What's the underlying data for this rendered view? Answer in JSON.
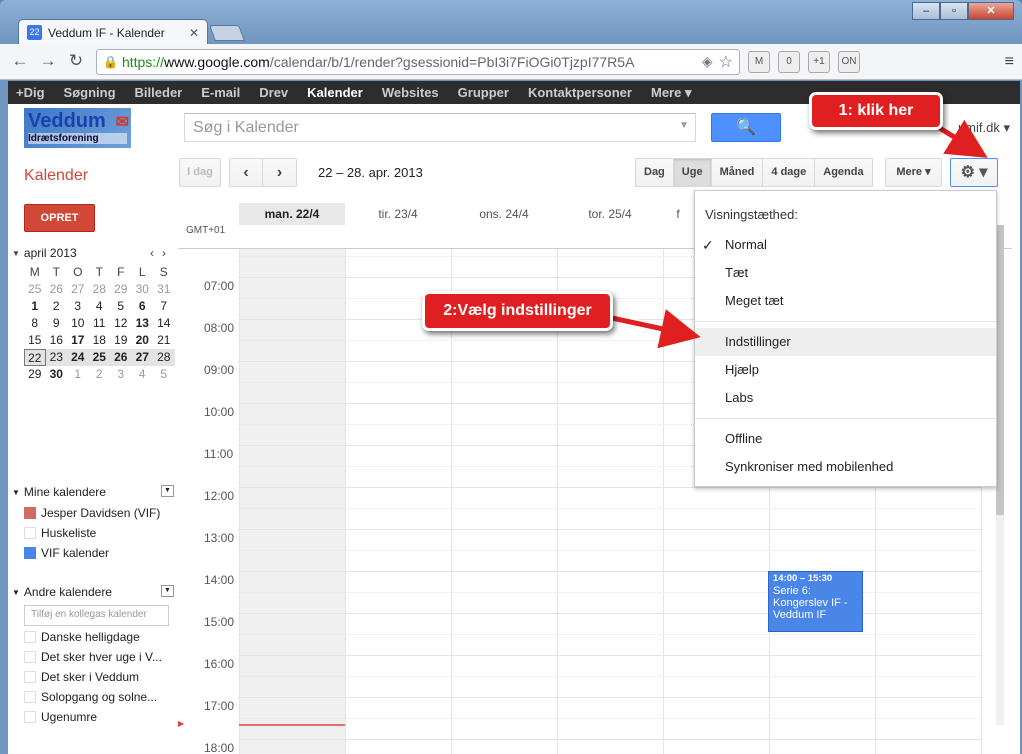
{
  "browser": {
    "tab_title": "Veddum IF - Kalender",
    "tab_favicon_text": "22",
    "url_scheme": "https://",
    "url_host": "www.google.com",
    "url_path": "/calendar/b/1/render?gsessionid=PbI3i7FiOGi0TjzpI77R5A",
    "ext_badge": "0"
  },
  "gbar": {
    "items": [
      "+Dig",
      "Søgning",
      "Billeder",
      "E-mail",
      "Drev",
      "Kalender",
      "Websites",
      "Grupper",
      "Kontaktpersoner",
      "Mere ▾"
    ],
    "active": "Kalender"
  },
  "header": {
    "logo_text": "Veddum",
    "logo_sub": "Idrætsforening",
    "search_placeholder": "Søg i Kalender",
    "account": "umif.dk ▾"
  },
  "calbar": {
    "app_name": "Kalender",
    "today_label": "I dag",
    "prev_label": "‹",
    "next_label": "›",
    "date_range": "22 – 28. apr. 2013",
    "views": [
      "Dag",
      "Uge",
      "Måned",
      "4 dage",
      "Agenda"
    ],
    "selected_view": "Uge",
    "more_label": "Mere ▾",
    "gear_label": "⚙ ▾"
  },
  "sidebar": {
    "create_label": "OPRET",
    "mini_month": "april 2013",
    "weekdays": [
      "M",
      "T",
      "O",
      "T",
      "F",
      "L",
      "S"
    ],
    "weeks": [
      [
        "25",
        "26",
        "27",
        "28",
        "29",
        "30",
        "31"
      ],
      [
        "1",
        "2",
        "3",
        "4",
        "5",
        "6",
        "7"
      ],
      [
        "8",
        "9",
        "10",
        "11",
        "12",
        "13",
        "14"
      ],
      [
        "15",
        "16",
        "17",
        "18",
        "19",
        "20",
        "21"
      ],
      [
        "22",
        "23",
        "24",
        "25",
        "26",
        "27",
        "28"
      ],
      [
        "29",
        "30",
        "1",
        "2",
        "3",
        "4",
        "5"
      ]
    ],
    "my_calendars_title": "Mine kalendere",
    "my_calendars": [
      {
        "label": "Jesper Davidsen (VIF)",
        "color": "#d06b64"
      },
      {
        "label": "Huskeliste",
        "color": "#ffffff"
      },
      {
        "label": "VIF kalender",
        "color": "#4986e7"
      }
    ],
    "other_calendars_title": "Andre kalendere",
    "add_colleague_placeholder": "Tilføj en kollegas kalender",
    "other_calendars": [
      "Danske helligdage",
      "Det sker hver uge i V...",
      "Det sker i Veddum",
      "Solopgang og solne...",
      "Ugenumre"
    ]
  },
  "grid": {
    "timezone": "GMT+01",
    "days": [
      "man. 22/4",
      "tir. 23/4",
      "ons. 24/4",
      "tor. 25/4",
      "f"
    ],
    "hours": [
      "07:00",
      "08:00",
      "09:00",
      "10:00",
      "11:00",
      "12:00",
      "13:00",
      "14:00",
      "15:00",
      "16:00",
      "17:00",
      "18:00"
    ],
    "event": {
      "time": "14:00 – 15:30",
      "title": "Serie 6: Kongerslev IF - Veddum IF"
    }
  },
  "settings_menu": {
    "heading": "Visningstæthed:",
    "density": [
      "Normal",
      "Tæt",
      "Meget tæt"
    ],
    "selected_density": "Normal",
    "items": [
      "Indstillinger",
      "Hjælp",
      "Labs"
    ],
    "items2": [
      "Offline",
      "Synkroniser med mobilenhed"
    ]
  },
  "annotations": {
    "step1": "1:  klik   her",
    "step2": "2:Vælg  indstillinger"
  }
}
